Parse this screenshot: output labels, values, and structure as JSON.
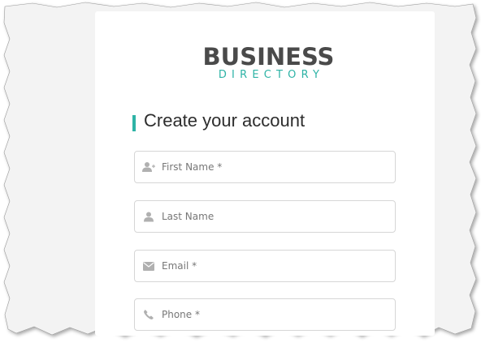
{
  "logo": {
    "main": "BUSINESS",
    "sub": "DIRECTORY"
  },
  "form": {
    "heading": "Create your account",
    "fields": [
      {
        "placeholder": "First Name *",
        "icon": "add-user-icon",
        "value": ""
      },
      {
        "placeholder": "Last Name",
        "icon": "user-icon",
        "value": ""
      },
      {
        "placeholder": "Email *",
        "icon": "envelope-icon",
        "value": ""
      },
      {
        "placeholder": "Phone *",
        "icon": "phone-icon",
        "value": ""
      }
    ]
  },
  "colors": {
    "accent": "#2eb3a6",
    "logo_text": "#4a4a4a",
    "icon": "#b0b0b0",
    "field_border": "#d6d6d6"
  }
}
